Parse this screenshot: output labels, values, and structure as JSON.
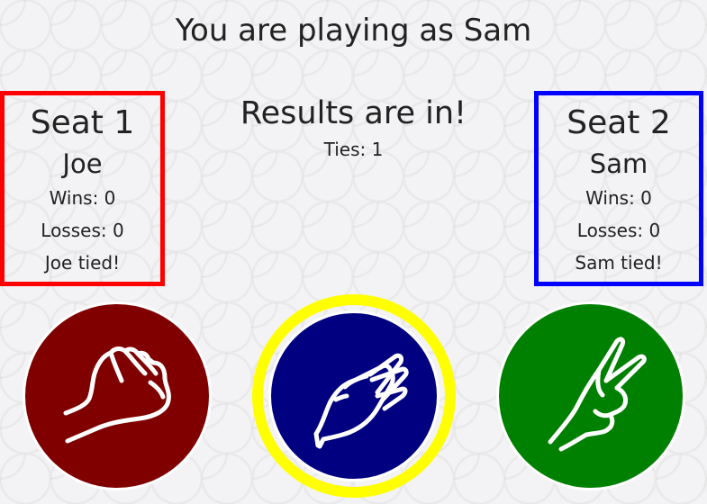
{
  "header": {
    "title": "You are playing as Sam"
  },
  "seats": [
    {
      "title": "Seat 1",
      "player": "Joe",
      "wins": "Wins: 0",
      "losses": "Losses: 0",
      "status": "Joe tied!",
      "border_color": "#ff0000"
    },
    {
      "title": "Seat 2",
      "player": "Sam",
      "wins": "Wins: 0",
      "losses": "Losses: 0",
      "status": "Sam tied!",
      "border_color": "#0000ff"
    }
  ],
  "result": {
    "title": "Results are in!",
    "ties": "Ties: 1"
  },
  "choices": [
    {
      "name": "rock",
      "icon": "rock-fist-icon",
      "color": "#800000",
      "selected": false
    },
    {
      "name": "paper",
      "icon": "paper-hand-icon",
      "color": "#000080",
      "selected": true,
      "highlight_color": "#ffff00"
    },
    {
      "name": "scissors",
      "icon": "scissors-hand-icon",
      "color": "#008000",
      "selected": false
    }
  ]
}
